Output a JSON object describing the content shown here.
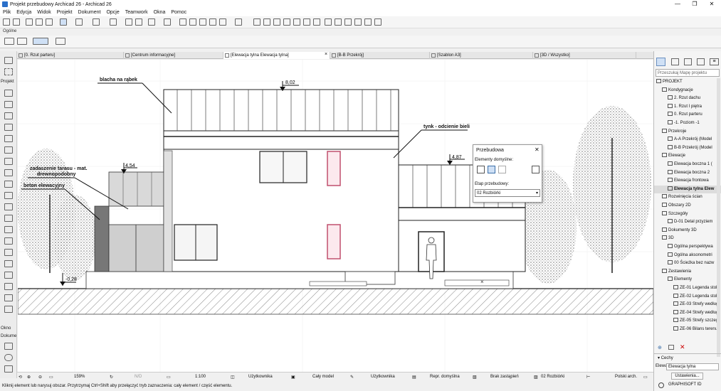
{
  "window": {
    "title": "Projekt przebudowy Archicad 26 - Archicad 26",
    "minimize": "—",
    "restore": "❐",
    "close": "✕"
  },
  "menu": [
    "Plik",
    "Edycja",
    "Widok",
    "Projekt",
    "Dokument",
    "Opcje",
    "Teamwork",
    "Okna",
    "Pomoc"
  ],
  "info_label": "Ogólne",
  "toolbox": {
    "select_label": "Projekt",
    "okno": "Okno",
    "dokume": "Dokume"
  },
  "tabs": [
    {
      "label": "[0. Rzut parteru]"
    },
    {
      "label": "[Centrum informacyjne]"
    },
    {
      "label": "[Elewacja tylna Elewacja tylna]"
    },
    {
      "label": "[B-B Przekrój]"
    },
    {
      "label": "[Szablon A3]"
    },
    {
      "label": "[3D / Wszystko]"
    }
  ],
  "drawing": {
    "labels": {
      "blacha": "blacha na rąbek",
      "tynk": "tynk - odcienie bieli",
      "zadaszenie1": "zadaszenie tarasu - mat.",
      "zadaszenie2": "drewnopodobny",
      "beton": "beton elewacyjny"
    },
    "levels": {
      "top": "8,02",
      "mid": "4,87",
      "left": "4,54",
      "base": "-0,28"
    }
  },
  "palette": {
    "title": "Przebudowa",
    "elementy_label": "Elementy domyślne:",
    "etap_label": "Etap przebudowy:",
    "etap_value": "02 Rozbiórki"
  },
  "navigator": {
    "search_placeholder": "Przeszukaj Mapę projektu",
    "items": [
      {
        "label": "PROJEKT",
        "level": 0
      },
      {
        "label": "Kondygnacje",
        "level": 1
      },
      {
        "label": "2. Rzut dachu",
        "level": 2
      },
      {
        "label": "1. Rzut I piętra",
        "level": 2
      },
      {
        "label": "0. Rzut parteru",
        "level": 2
      },
      {
        "label": "-1. Poziom -1",
        "level": 2
      },
      {
        "label": "Przekroje",
        "level": 1
      },
      {
        "label": "A-A Przekrój (Model",
        "level": 2
      },
      {
        "label": "B-B Przekrój (Model",
        "level": 2
      },
      {
        "label": "Elewacje",
        "level": 1
      },
      {
        "label": "Elewacja boczna 1 (",
        "level": 2
      },
      {
        "label": "Elewacja boczna 2",
        "level": 2
      },
      {
        "label": "Elewacja frontowa",
        "level": 2
      },
      {
        "label": "Elewacja tylna Elew",
        "level": 2,
        "selected": true
      },
      {
        "label": "Rozwinięcia ścian",
        "level": 1
      },
      {
        "label": "Obszary 2D",
        "level": 1
      },
      {
        "label": "Szczegóły",
        "level": 1
      },
      {
        "label": "D-01 Detal przyziem",
        "level": 2
      },
      {
        "label": "Dokumenty 3D",
        "level": 1
      },
      {
        "label": "3D",
        "level": 1
      },
      {
        "label": "Ogólna perspektywa",
        "level": 2
      },
      {
        "label": "Ogólna aksonometri",
        "level": 2
      },
      {
        "label": "00 Ścieżka bez nazw",
        "level": 2
      },
      {
        "label": "Zestawienia",
        "level": 1
      },
      {
        "label": "Elementy",
        "level": 2
      },
      {
        "label": "ZE-01 Legenda stol",
        "level": 3
      },
      {
        "label": "ZE-02 Legenda stol",
        "level": 3
      },
      {
        "label": "ZE-03 Strefy według",
        "level": 3
      },
      {
        "label": "ZE-04 Strefy według",
        "level": 3
      },
      {
        "label": "ZE-05 Strefy szczeg",
        "level": 3
      },
      {
        "label": "ZE-06 Bilans terenu",
        "level": 3
      }
    ],
    "cechy_label": "Cechy",
    "cechy_short": "Elewa",
    "cechy_value": "Elewacja tylna",
    "settings_button": "Ustawienia...",
    "graphisoft": "GRAPHISOFT ID"
  },
  "status": {
    "zoom": "159%",
    "angle": "N/D",
    "scale": "1:100",
    "layer": "Użytkownika",
    "model": "Cały model",
    "pen": "Użytkownika",
    "repr": "Repr. domyślna",
    "override": "Brak zastąpień",
    "phase": "02 Rozbiórki",
    "dim": "Polski arch."
  },
  "hint": "Kliknij element lub narysuj obszar. Przytrzymaj Ctrl+Shift aby przełączyć tryb zaznaczenia: cały element / część elementu."
}
